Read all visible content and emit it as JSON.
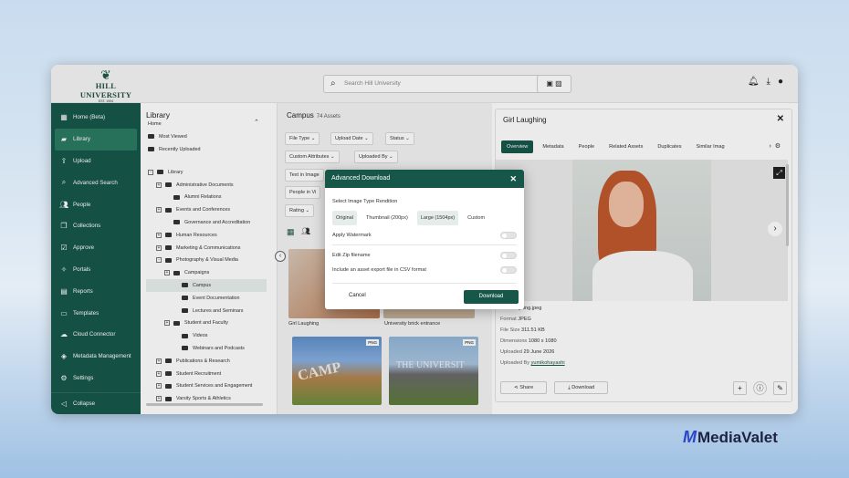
{
  "header": {
    "logo_name": "HILL UNIVERSITY",
    "logo_est": "EST. 1904",
    "search_placeholder": "Search Hill University"
  },
  "sidebar": {
    "items": [
      {
        "label": "Home (Beta)",
        "icon": "grid-icon"
      },
      {
        "label": "Library",
        "icon": "folder-icon"
      },
      {
        "label": "Upload",
        "icon": "upload-icon"
      },
      {
        "label": "Advanced Search",
        "icon": "search-icon"
      },
      {
        "label": "People",
        "icon": "people-icon"
      },
      {
        "label": "Collections",
        "icon": "collections-icon"
      },
      {
        "label": "Approve",
        "icon": "approve-icon"
      },
      {
        "label": "Portals",
        "icon": "portals-icon"
      },
      {
        "label": "Reports",
        "icon": "reports-icon"
      },
      {
        "label": "Templates",
        "icon": "templates-icon"
      },
      {
        "label": "Cloud Connector",
        "icon": "cloud-icon"
      },
      {
        "label": "Metadata Management",
        "icon": "metadata-icon"
      },
      {
        "label": "Settings",
        "icon": "gear-icon"
      }
    ],
    "collapse_label": "Collapse"
  },
  "library": {
    "title": "Library",
    "subtitle": "Home",
    "quick": [
      "Most Viewed",
      "Recently Uploaded"
    ],
    "tree": [
      "Library",
      "Administrative Documents",
      "Alumni Relations",
      "Events and Conferences",
      "Governance and Accreditation",
      "Human Resources",
      "Marketing & Communications",
      "Photography & Visual Media",
      "Campaigns",
      "Campus",
      "Event Documentation",
      "Lectures and Seminars",
      "Student and Faculty",
      "Videos",
      "Webinars and Podcasts",
      "Publications & Research",
      "Student Recruitment",
      "Student Services and Engagement",
      "Varsity Sports & Athletics"
    ]
  },
  "center": {
    "title": "Campus",
    "count": "74 Assets",
    "filters": [
      "File Type",
      "Upload Date",
      "Status",
      "Custom Attributes",
      "Uploaded By",
      "Text in Image",
      "People in Vi",
      "Rating"
    ],
    "thumbs": [
      {
        "label": "Girl Laughing"
      },
      {
        "label": "University brick entrance"
      },
      {
        "badge": "PNG",
        "text": "CAMP"
      },
      {
        "badge": "PNG",
        "text": "THE UNIVERSIT"
      }
    ]
  },
  "detail": {
    "title": "Girl Laughing",
    "tabs": [
      "Overview",
      "Metadata",
      "People",
      "Related Assets",
      "Duplicates",
      "Similar Imag"
    ],
    "meta": [
      {
        "k": "",
        "v": "Girl Laughing.jpeg"
      },
      {
        "k": "Format",
        "v": "JPEG"
      },
      {
        "k": "File Size",
        "v": "311.51 KB"
      },
      {
        "k": "Dimensions",
        "v": "1080 x 1080"
      },
      {
        "k": "Uploaded",
        "v": "29 June 2026"
      },
      {
        "k": "Uploaded By",
        "v": "yumikohayashi"
      }
    ],
    "share_label": "Share",
    "download_label": "Download"
  },
  "modal": {
    "title": "Advanced Download",
    "section": "Select Image Type Rendition",
    "options": [
      "Original",
      "Thumbnail (200px)",
      "Large (1504px)",
      "Custom"
    ],
    "watermark": "Apply Watermark",
    "zip": "Edit Zip filename",
    "csv": "Include an asset export file in CSV format",
    "cancel": "Cancel",
    "download": "Download"
  },
  "brand": {
    "mark": "M",
    "name": "MediaValet"
  },
  "colors": {
    "primary": "#17574a",
    "accent": "#2b7a62"
  }
}
